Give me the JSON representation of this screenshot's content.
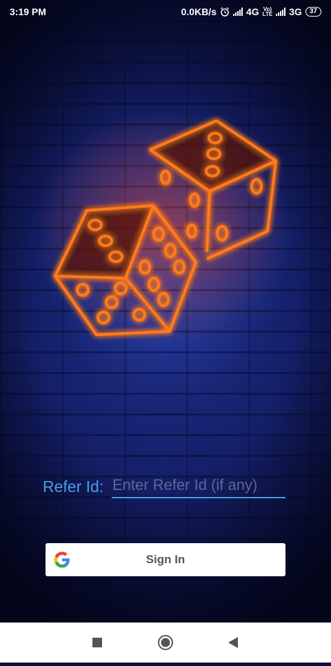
{
  "status_bar": {
    "time": "3:19 PM",
    "speed": "0.0KB/s",
    "network_1": "4G",
    "volte_top": "Vo)",
    "volte_bottom": "LTE",
    "network_2": "3G",
    "battery": "37"
  },
  "hero": {
    "image": "neon-dice-icon",
    "glow_color": "#ff5a10"
  },
  "refer": {
    "label": "Refer Id:",
    "placeholder": "Enter Refer Id (if any)",
    "value": ""
  },
  "signin": {
    "label": "Sign In",
    "icon": "google-icon"
  },
  "navigation": {
    "items": [
      "recent-apps-icon",
      "home-icon",
      "back-icon"
    ]
  },
  "colors": {
    "accent": "#4a9be6",
    "background": "#15206a",
    "neon": "#ff5a10"
  }
}
